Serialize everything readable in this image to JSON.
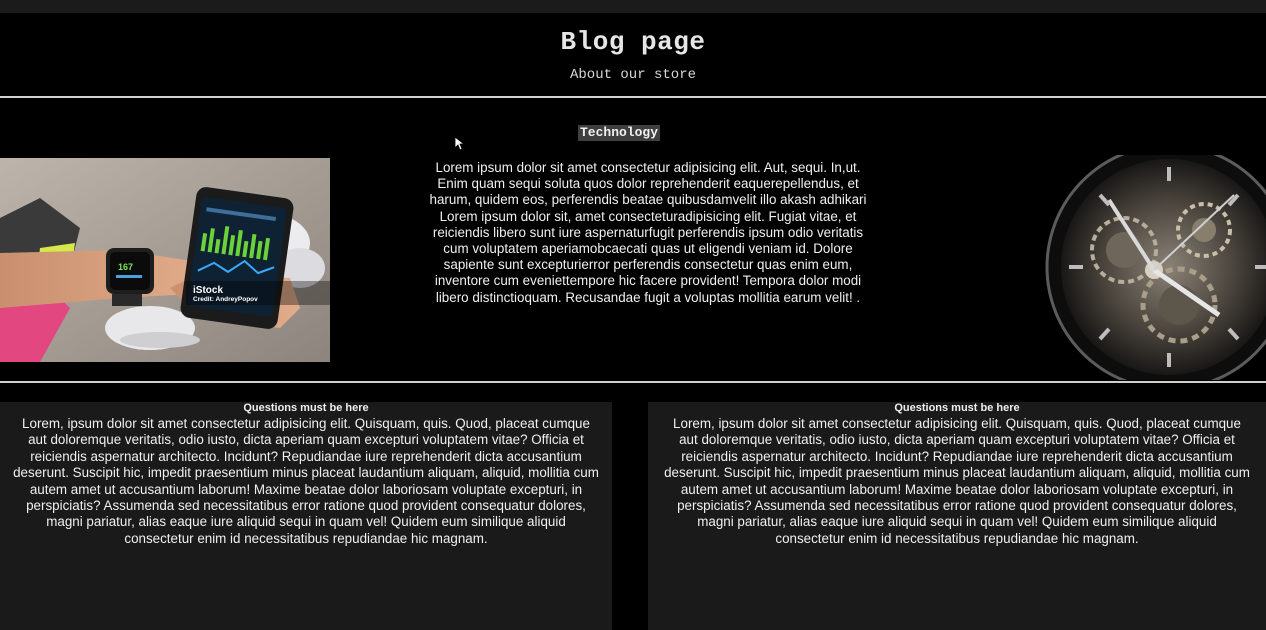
{
  "header": {
    "title": "Blog page",
    "subtitle": "About our store"
  },
  "article": {
    "category": "Technology",
    "body_lines": [
      "Lorem ipsum dolor sit amet consectetur adipisicing elit. Aut, sequi. In,",
      "ut. Enim quam sequi soluta quos dolor reprehenderit eaque",
      "repellendus, et harum, quidem eos, perferendis beatae quibusdam",
      "velit illo akash adhikari Lorem ipsum dolor sit, amet consectetur",
      "adipisicing elit. Fugiat vitae, et reiciendis libero sunt iure aspernatur",
      "fugit perferendis ipsum odio veritatis cum voluptatem aperiam",
      "obcaecati quas ut eligendi veniam id. Dolore sapiente sunt excepturi",
      "error perferendis consectetur quas enim eum, inventore cum eveniet",
      "tempore hic facere provident! Tempora dolor modi libero distinctio",
      "quam. Recusandae fugit a voluptas mollitia earum velit! ."
    ],
    "left_image": {
      "watermark": "iStock",
      "credit": "Credit: AndreyPopov",
      "display_value": "167"
    },
    "right_image": {
      "icon": "mechanical-watch"
    }
  },
  "questions": [
    {
      "title": "Questions must be here",
      "lines": [
        "Lorem, ipsum dolor sit amet consectetur adipisicing elit. Quisquam, quis. Quod, placeat cumque",
        "aut doloremque veritatis, odio iusto, dicta aperiam quam excepturi voluptatem vitae? Officia et",
        "reiciendis aspernatur architecto. Incidunt? Repudiandae iure reprehenderit dicta accusantium",
        "deserunt. Suscipit hic, impedit praesentium minus placeat laudantium aliquam, aliquid, mollitia cum",
        "autem amet ut accusantium laborum! Maxime beatae dolor laboriosam voluptate excepturi, in",
        "perspiciatis? Assumenda sed necessitatibus error ratione quod provident consequatur dolores,",
        "magni pariatur, alias eaque iure aliquid sequi in quam vel! Quidem eum similique aliquid",
        "consectetur enim id necessitatibus repudiandae hic magnam."
      ]
    },
    {
      "title": "Questions must be here",
      "lines": [
        "Lorem, ipsum dolor sit amet consectetur adipisicing elit. Quisquam, quis. Quod, placeat cumque",
        "aut doloremque veritatis, odio iusto, dicta aperiam quam excepturi voluptatem vitae? Officia et",
        "reiciendis aspernatur architecto. Incidunt? Repudiandae iure reprehenderit dicta accusantium",
        "deserunt. Suscipit hic, impedit praesentium minus placeat laudantium aliquam, aliquid, mollitia cum",
        "autem amet ut accusantium laborum! Maxime beatae dolor laboriosam voluptate excepturi, in",
        "perspiciatis? Assumenda sed necessitatibus error ratione quod provident consequatur dolores,",
        "magni pariatur, alias eaque iure aliquid sequi in quam vel! Quidem eum similique aliquid",
        "consectetur enim id necessitatibus repudiandae hic magnam."
      ]
    }
  ],
  "colors": {
    "background": "#000000",
    "card": "#1a1a1a",
    "rule": "#cfcfcf",
    "category_highlight": "#3f3f3f"
  }
}
